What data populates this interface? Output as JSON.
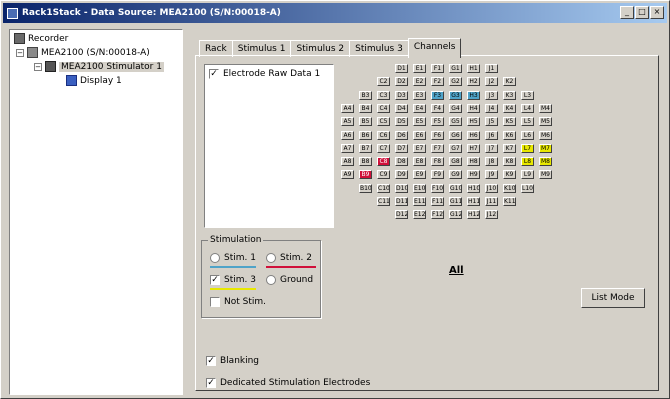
{
  "window": {
    "title": "Rack1Stack - Data Source: MEA2100 (S/N:00018-A)",
    "buttons": [
      "_",
      "□",
      "×"
    ]
  },
  "tree": {
    "items": [
      {
        "label": "Recorder",
        "icon": "recorder-icon"
      },
      {
        "label": "MEA2100 (S/N:00018-A)",
        "icon": "device-icon"
      },
      {
        "label": "MEA2100 Stimulator 1",
        "icon": "stimulator-icon"
      },
      {
        "label": "Display 1",
        "icon": "display-icon"
      }
    ]
  },
  "tabs": [
    "Rack",
    "Stimulus 1",
    "Stimulus 2",
    "Stimulus 3",
    "Channels"
  ],
  "active_tab": "Channels",
  "channels": {
    "raw_data_label": "Electrode Raw Data 1",
    "stimulation": {
      "legend": "Stimulation",
      "stim1": "Stim. 1",
      "stim2": "Stim. 2",
      "stim3": "Stim. 3",
      "ground": "Ground",
      "not_stim": "Not Stim."
    },
    "all_label": "All",
    "list_mode_label": "List Mode",
    "blanking_label": "Blanking",
    "dedicated_label": "Dedicated Stimulation Electrodes",
    "colors": {
      "stim1": "#4fa3c8",
      "stim2": "#d0103a",
      "stim3": "#e8e800"
    },
    "rows": [
      [
        "D1",
        "E1",
        "F1",
        "G1",
        "H1",
        "J1"
      ],
      [
        "C2",
        "D2",
        "E2",
        "F2",
        "G2",
        "H2",
        "J2",
        "K2"
      ],
      [
        "B3",
        "C3",
        "D3",
        "E3",
        "F3",
        "G3",
        "H3",
        "J3",
        "K3",
        "L3"
      ],
      [
        "A4",
        "B4",
        "C4",
        "D4",
        "E4",
        "F4",
        "G4",
        "H4",
        "J4",
        "K4",
        "L4",
        "M4"
      ],
      [
        "A5",
        "B5",
        "C5",
        "D5",
        "E5",
        "F5",
        "G5",
        "H5",
        "J5",
        "K5",
        "L5",
        "M5"
      ],
      [
        "A6",
        "B6",
        "C6",
        "D6",
        "E6",
        "F6",
        "G6",
        "H6",
        "J6",
        "K6",
        "L6",
        "M6"
      ],
      [
        "A7",
        "B7",
        "C7",
        "D7",
        "E7",
        "F7",
        "G7",
        "H7",
        "J7",
        "K7",
        "L7",
        "M7"
      ],
      [
        "A8",
        "B8",
        "C8",
        "D8",
        "E8",
        "F8",
        "G8",
        "H8",
        "J8",
        "K8",
        "L8",
        "M8"
      ],
      [
        "A9",
        "B9",
        "C9",
        "D9",
        "E9",
        "F9",
        "G9",
        "H9",
        "J9",
        "K9",
        "L9",
        "M9"
      ],
      [
        "B10",
        "C10",
        "D10",
        "E10",
        "F10",
        "G10",
        "H10",
        "J10",
        "K10",
        "L10"
      ],
      [
        "C11",
        "D11",
        "E11",
        "F11",
        "G11",
        "H11",
        "J11",
        "K11"
      ],
      [
        "D12",
        "E12",
        "F12",
        "G12",
        "H12",
        "J12"
      ]
    ],
    "stim1_cells": [
      "F3",
      "G3",
      "H3"
    ],
    "stim2_cells": [
      "C8",
      "B9"
    ],
    "stim3_cells": [
      "L7",
      "M7",
      "L8",
      "M8"
    ]
  }
}
